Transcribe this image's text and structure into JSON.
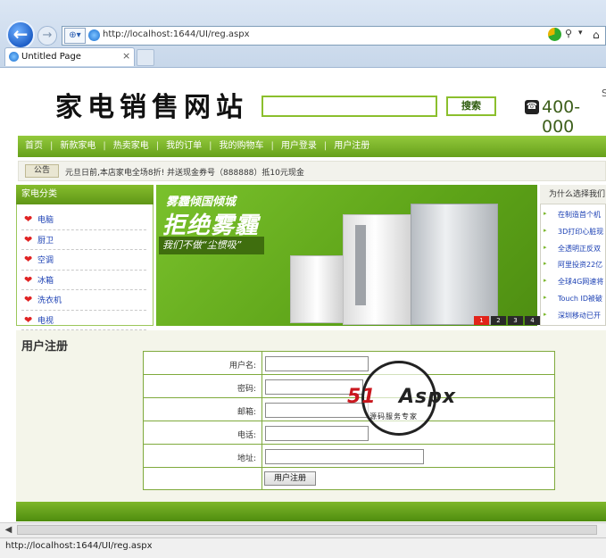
{
  "browser": {
    "url": "http://localhost:1644/UI/reg.aspx",
    "tab_title": "Untitled Page",
    "status_text": "http://localhost:1644/UI/reg.aspx"
  },
  "site": {
    "logo": "家电销售网站",
    "search_button": "搜索",
    "phone": "400-000",
    "top_right_fragment": "S"
  },
  "nav": {
    "items": [
      "首页",
      "新款家电",
      "热卖家电",
      "我的订单",
      "我的购物车",
      "用户登录",
      "用户注册"
    ]
  },
  "notice": {
    "badge": "公告",
    "text": "元旦日前,本店家电全场8折! 并送现金券号（888888）抵10元现金"
  },
  "categories": {
    "title": "家电分类",
    "items": [
      "电脑",
      "厨卫",
      "空调",
      "冰箱",
      "洗衣机",
      "电视"
    ]
  },
  "banner": {
    "line1": "雾霾倾国倾城",
    "line2": "拒绝雾霾",
    "line3": "我们不做“尘惯吸”",
    "pages": [
      "1",
      "2",
      "3",
      "4"
    ],
    "active_page": "1"
  },
  "why": {
    "title": "为什么选择我们",
    "items": [
      "在制造首个机",
      "3D打印心脏现",
      "全透明正反双",
      "阿里投资22亿",
      "全球4G网速将",
      "Touch ID被破",
      "深圳移动已开"
    ]
  },
  "register": {
    "title": "用户注册",
    "fields": [
      {
        "label": "用户名:",
        "value": ""
      },
      {
        "label": "密码:",
        "value": ""
      },
      {
        "label": "邮箱:",
        "value": ""
      },
      {
        "label": "电话:",
        "value": ""
      },
      {
        "label": "地址:",
        "value": ""
      }
    ],
    "submit_label": "用户注册"
  },
  "watermark": {
    "brand_a": "51",
    "brand_b": "Aspx",
    "sub": "源码服务专家"
  },
  "colors": {
    "brand_green": "#66a01b",
    "link_blue": "#1a3fb3",
    "heart_red": "#e02222"
  }
}
